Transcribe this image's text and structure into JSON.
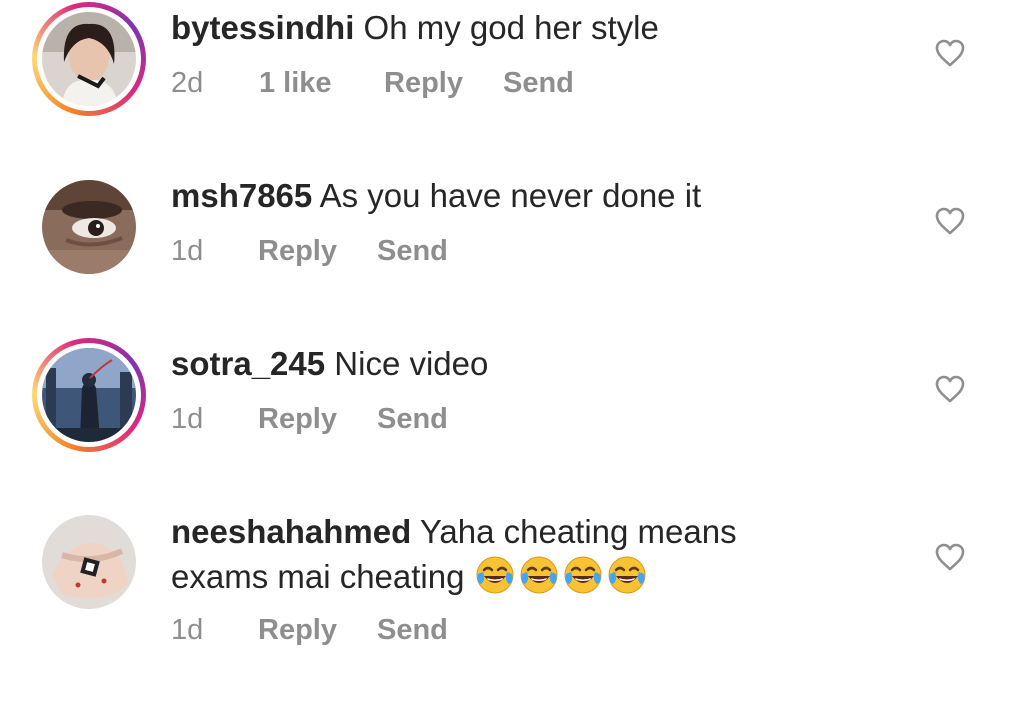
{
  "comments": [
    {
      "username": "bytessindhi",
      "text": "Oh my god her style",
      "time": "2d",
      "likes": "1 like",
      "reply": "Reply",
      "send": "Send",
      "story_ring": true,
      "avatar_icon": "user-photo"
    },
    {
      "username": "msh7865",
      "text": "As you have never done it",
      "time": "1d",
      "reply": "Reply",
      "send": "Send",
      "story_ring": false,
      "avatar_icon": "user-photo"
    },
    {
      "username": "sotra_245",
      "text": "Nice video",
      "time": "1d",
      "reply": "Reply",
      "send": "Send",
      "story_ring": true,
      "avatar_icon": "user-photo"
    },
    {
      "username": "neeshahahmed",
      "text_line1": "Yaha cheating means",
      "text_line2": "exams mai cheating",
      "emojis": [
        "😂",
        "😂",
        "😂",
        "😂"
      ],
      "time": "1d",
      "reply": "Reply",
      "send": "Send",
      "story_ring": false,
      "avatar_icon": "user-photo"
    }
  ],
  "colors": {
    "text": "#262626",
    "meta": "#8e8e8e",
    "heart_stroke": "#8e8e8e",
    "emoji_face": "#f7c234",
    "emoji_tears": "#42a5f5"
  }
}
